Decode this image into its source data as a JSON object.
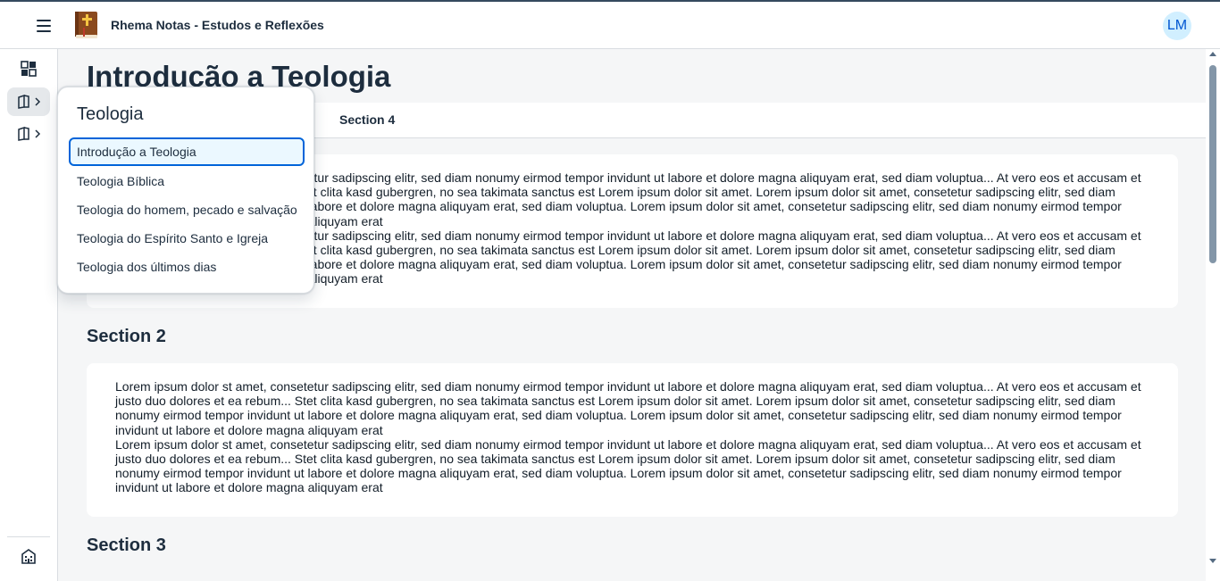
{
  "header": {
    "app_title": "Rhema Notas - Estudos e Reflexões",
    "avatar_initials": "LM",
    "accent_color": "#0064d9"
  },
  "sidenav": {
    "items": [
      {
        "icon": "dashboard-icon",
        "selected": false
      },
      {
        "icon": "book-icon",
        "selected": true,
        "has_submenu": true
      },
      {
        "icon": "book-icon",
        "selected": false,
        "has_submenu": true
      }
    ],
    "bottom_item": {
      "icon": "building-icon"
    }
  },
  "main": {
    "page_title": "Introdução a Teologia",
    "visible_tab": "Section 4",
    "section_1_paragraphs": [
      "Lorem ipsum dolor st amet, consetetur sadipscing elitr, sed diam nonumy eirmod tempor invidunt ut labore et dolore magna aliquyam erat, sed diam voluptua... At vero eos et accusam et justo duo dolores et ea rebum... Stet clita kasd gubergren, no sea takimata sanctus est Lorem ipsum dolor sit amet. Lorem ipsum dolor sit amet, consetetur sadipscing elitr, sed diam nonumy eirmod tempor invidunt ut labore et dolore magna aliquyam erat, sed diam voluptua. Lorem ipsum dolor sit amet, consetetur sadipscing elitr, sed diam nonumy eirmod tempor invidunt ut labore et dolore magna aliquyam erat",
      "Lorem ipsum dolor st amet, consetetur sadipscing elitr, sed diam nonumy eirmod tempor invidunt ut labore et dolore magna aliquyam erat, sed diam voluptua... At vero eos et accusam et justo duo dolores et ea rebum... Stet clita kasd gubergren, no sea takimata sanctus est Lorem ipsum dolor sit amet. Lorem ipsum dolor sit amet, consetetur sadipscing elitr, sed diam nonumy eirmod tempor invidunt ut labore et dolore magna aliquyam erat, sed diam voluptua. Lorem ipsum dolor sit amet, consetetur sadipscing elitr, sed diam nonumy eirmod tempor invidunt ut labore et dolore magna aliquyam erat"
    ],
    "section_2_heading": "Section 2",
    "section_2_paragraphs": [
      "Lorem ipsum dolor st amet, consetetur sadipscing elitr, sed diam nonumy eirmod tempor invidunt ut labore et dolore magna aliquyam erat, sed diam voluptua... At vero eos et accusam et justo duo dolores et ea rebum... Stet clita kasd gubergren, no sea takimata sanctus est Lorem ipsum dolor sit amet. Lorem ipsum dolor sit amet, consetetur sadipscing elitr, sed diam nonumy eirmod tempor invidunt ut labore et dolore magna aliquyam erat, sed diam voluptua. Lorem ipsum dolor sit amet, consetetur sadipscing elitr, sed diam nonumy eirmod tempor invidunt ut labore et dolore magna aliquyam erat",
      "Lorem ipsum dolor st amet, consetetur sadipscing elitr, sed diam nonumy eirmod tempor invidunt ut labore et dolore magna aliquyam erat, sed diam voluptua... At vero eos et accusam et justo duo dolores et ea rebum... Stet clita kasd gubergren, no sea takimata sanctus est Lorem ipsum dolor sit amet. Lorem ipsum dolor sit amet, consetetur sadipscing elitr, sed diam nonumy eirmod tempor invidunt ut labore et dolore magna aliquyam erat, sed diam voluptua. Lorem ipsum dolor sit amet, consetetur sadipscing elitr, sed diam nonumy eirmod tempor invidunt ut labore et dolore magna aliquyam erat"
    ],
    "section_3_heading": "Section 3"
  },
  "popover": {
    "title": "Teologia",
    "items": [
      {
        "label": "Introdução a Teologia",
        "selected": true
      },
      {
        "label": "Teologia Bíblica",
        "selected": false
      },
      {
        "label": "Teologia do homem, pecado e salvação",
        "selected": false
      },
      {
        "label": "Teologia do Espírito Santo e Igreja",
        "selected": false
      },
      {
        "label": "Teologia dos últimos dias",
        "selected": false
      }
    ]
  }
}
